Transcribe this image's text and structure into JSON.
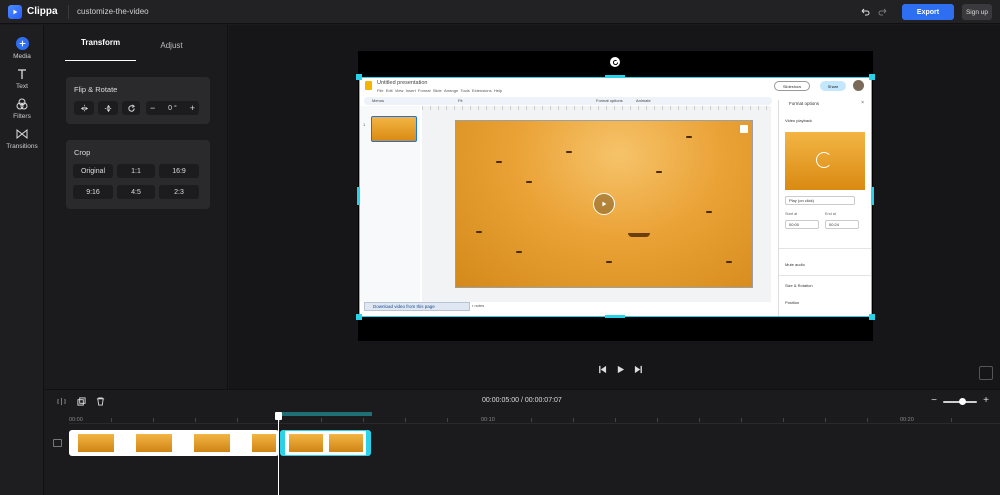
{
  "app": {
    "name": "Clippa",
    "project_name": "customize-the-video"
  },
  "topbar": {
    "export_label": "Export",
    "signup_label": "Sign up"
  },
  "rail": [
    {
      "label": "Media",
      "icon": "plus-icon"
    },
    {
      "label": "Text",
      "icon": "text-icon"
    },
    {
      "label": "Filters",
      "icon": "filters-icon"
    },
    {
      "label": "Transitions",
      "icon": "transitions-icon"
    }
  ],
  "panel": {
    "tabs": [
      "Transform",
      "Adjust"
    ],
    "active_tab": "Transform",
    "flip_rotate": {
      "title": "Flip & Rotate",
      "rotation_value": "0",
      "degree_symbol": "°"
    },
    "crop": {
      "title": "Crop",
      "options": [
        "Original",
        "1:1",
        "16:9",
        "9:16",
        "4:5",
        "2:3"
      ]
    }
  },
  "slides_mock": {
    "title": "Untitled presentation",
    "menu": [
      "File",
      "Edit",
      "View",
      "Insert",
      "Format",
      "Slide",
      "Arrange",
      "Tools",
      "Extensions",
      "Help"
    ],
    "toolbar_menus": "Menus",
    "toolbar_fit": "Fit",
    "toolbar_format_options": "Format options",
    "toolbar_animate": "Animate",
    "slideshow": "Slideshow",
    "share": "Share",
    "slide_number": "1",
    "download_bar": "Download video from this page",
    "speaker_notes": "r notes",
    "format_panel": {
      "title": "Format options",
      "video_playback": "Video playback",
      "play_mode": "Play (on click)",
      "start_label": "Start at",
      "end_label": "End at",
      "start_value": "00:00",
      "end_value": "00:24",
      "mute": "Mute audio",
      "size_rotation": "Size & Rotation",
      "position": "Position"
    }
  },
  "timeline": {
    "current_time": "00:00:05:00",
    "separator": "/",
    "total_time": "00:00:07:07",
    "ruler_labels": [
      "00:00",
      "00:10",
      "00:20"
    ]
  },
  "colors": {
    "accent": "#2e6ff2",
    "selection": "#2ad1e8",
    "background": "#1b1b1d"
  }
}
